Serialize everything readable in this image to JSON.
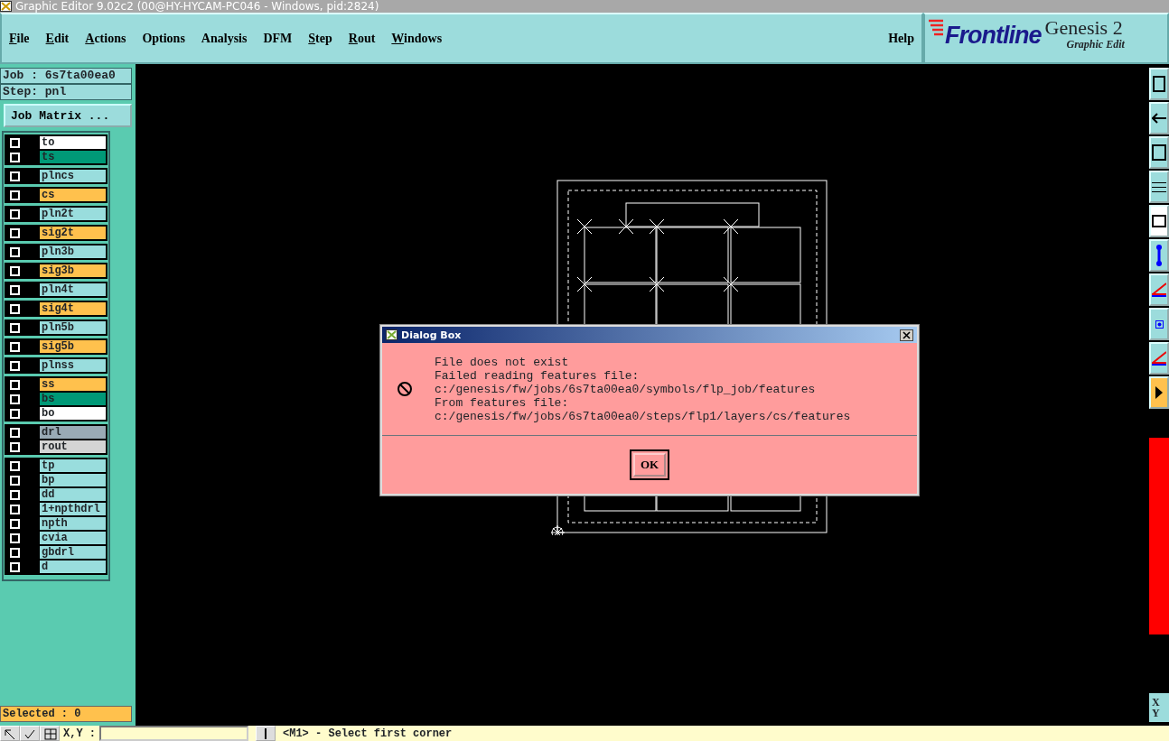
{
  "window": {
    "title": "Graphic Editor 9.02c2 (00@HY-HYCAM-PC046 - Windows, pid:2824)"
  },
  "menu": [
    {
      "label": "File",
      "mnemonic": true
    },
    {
      "label": "Edit",
      "mnemonic": true
    },
    {
      "label": "Actions",
      "mnemonic": true
    },
    {
      "label": "Options",
      "mnemonic": false
    },
    {
      "label": "Analysis",
      "mnemonic": false
    },
    {
      "label": "DFM",
      "mnemonic": false
    },
    {
      "label": "Step",
      "mnemonic": true
    },
    {
      "label": "Rout",
      "mnemonic": true
    },
    {
      "label": "Windows",
      "mnemonic": true
    }
  ],
  "help": "Help",
  "logo": {
    "brand": "Frontline",
    "product": "Genesis 2",
    "subtitle": "Graphic Edit"
  },
  "job": "Job : 6s7ta00ea0",
  "step": "Step: pnl",
  "job_matrix_button": "Job Matrix ...",
  "layer_groups": [
    {
      "layers": [
        {
          "name": "to",
          "color": "#ffffff",
          "checked": false
        },
        {
          "name": "ts",
          "color": "#009977",
          "checked": false
        }
      ]
    },
    {
      "layers": [
        {
          "name": "plncs",
          "color": "#99dddd",
          "checked": false
        }
      ]
    },
    {
      "layers": [
        {
          "name": "cs",
          "color": "#ffc14d",
          "checked": false
        }
      ]
    },
    {
      "layers": [
        {
          "name": "pln2t",
          "color": "#99dddd",
          "checked": false
        }
      ]
    },
    {
      "layers": [
        {
          "name": "sig2t",
          "color": "#ffc14d",
          "checked": false
        }
      ]
    },
    {
      "layers": [
        {
          "name": "pln3b",
          "color": "#99dddd",
          "checked": false
        }
      ]
    },
    {
      "layers": [
        {
          "name": "sig3b",
          "color": "#ffc14d",
          "checked": false
        }
      ]
    },
    {
      "layers": [
        {
          "name": "pln4t",
          "color": "#99dddd",
          "checked": false
        }
      ]
    },
    {
      "layers": [
        {
          "name": "sig4t",
          "color": "#ffc14d",
          "checked": false
        }
      ]
    },
    {
      "layers": [
        {
          "name": "pln5b",
          "color": "#99dddd",
          "checked": false
        }
      ]
    },
    {
      "layers": [
        {
          "name": "sig5b",
          "color": "#ffc14d",
          "checked": false
        }
      ]
    },
    {
      "layers": [
        {
          "name": "plnss",
          "color": "#99dddd",
          "checked": false
        }
      ]
    },
    {
      "layers": [
        {
          "name": "ss",
          "color": "#ffc14d",
          "checked": false
        },
        {
          "name": "bs",
          "color": "#009977",
          "checked": false
        },
        {
          "name": "bo",
          "color": "#ffffff",
          "checked": false
        }
      ]
    },
    {
      "layers": [
        {
          "name": "drl",
          "color": "#99aab5",
          "checked": false
        },
        {
          "name": "rout",
          "color": "#d4d4d4",
          "checked": false
        }
      ]
    },
    {
      "layers": [
        {
          "name": "tp",
          "color": "#99dddd",
          "checked": false
        },
        {
          "name": "bp",
          "color": "#99dddd",
          "checked": false
        },
        {
          "name": "dd",
          "color": "#99dddd",
          "checked": false
        },
        {
          "name": "1+npthdrl",
          "color": "#99dddd",
          "checked": false
        },
        {
          "name": "npth",
          "color": "#99dddd",
          "checked": false
        },
        {
          "name": "cvia",
          "color": "#99dddd",
          "checked": false
        },
        {
          "name": "gbdrl",
          "color": "#99dddd",
          "checked": false
        },
        {
          "name": "d",
          "color": "#99dddd",
          "checked": false
        }
      ]
    }
  ],
  "selected": "Selected : 0",
  "dialog": {
    "title": "Dialog Box",
    "lines": [
      "File does not exist",
      "Failed reading features file:",
      "c:/genesis/fw/jobs/6s7ta00ea0/symbols/flp_job/features",
      "From features file:",
      "c:/genesis/fw/jobs/6s7ta00ea0/steps/flp1/layers/cs/features"
    ],
    "button": "OK"
  },
  "axis_labels": [
    "X",
    "Y"
  ],
  "coords_label": "X,Y :",
  "prompt": "<M1> - Select first corner"
}
